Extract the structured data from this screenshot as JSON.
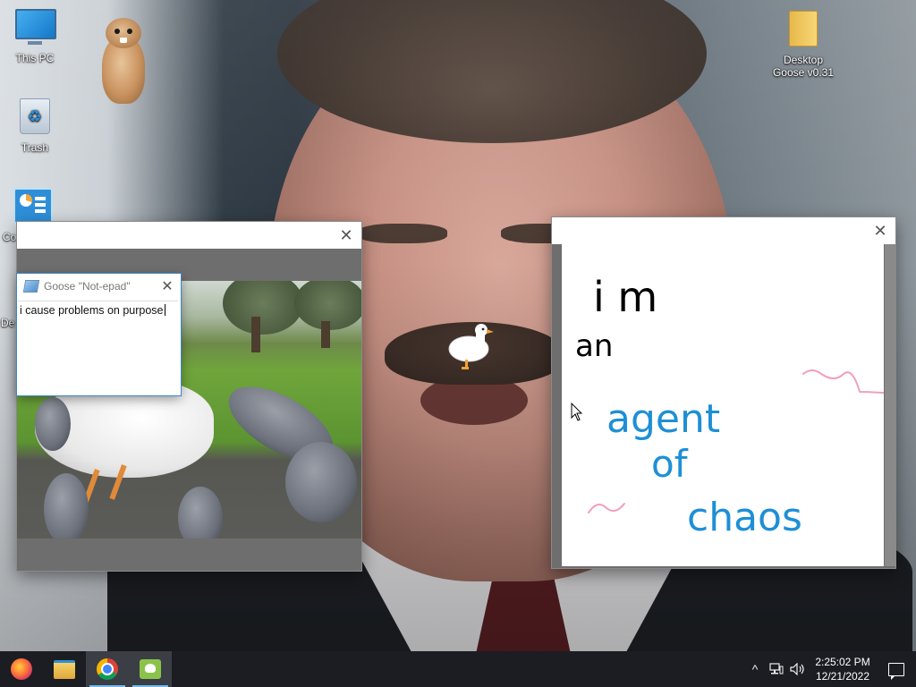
{
  "desktop": {
    "icons": [
      {
        "label": "This PC",
        "icon": "computer-icon"
      },
      {
        "label": "Trash",
        "icon": "recycle-bin-icon"
      },
      {
        "label": "Co",
        "icon": "control-panel-icon"
      },
      {
        "label": "De",
        "icon": "desktop-shortcut-icon"
      },
      {
        "label": "Desktop Goose v0.31",
        "icon": "folder-icon"
      }
    ],
    "gopher_sticker": "gopher-icon"
  },
  "windows": {
    "gif_viewer": {
      "close_label": "✕"
    },
    "notepad": {
      "title": "Goose \"Not-epad\"",
      "close_label": "✕",
      "text": "i cause problems on purpose"
    },
    "doodle": {
      "close_label": "✕",
      "lines": [
        "i m",
        "an",
        "agent",
        "of",
        "chaos"
      ],
      "colors": {
        "black_text": "#000000",
        "blue_text": "#1e8fd6",
        "pink_scribble": "#f0a0b8"
      }
    }
  },
  "taskbar": {
    "apps": [
      {
        "name": "Firefox",
        "icon": "firefox-icon"
      },
      {
        "name": "File Explorer",
        "icon": "file-explorer-icon"
      },
      {
        "name": "Google Chrome",
        "icon": "chrome-icon",
        "active": true
      },
      {
        "name": "Desktop Goose",
        "icon": "goose-app-icon",
        "active": true
      }
    ],
    "tray": {
      "chevron": "^",
      "time": "2:25:02 PM",
      "date": "12/21/2022"
    },
    "accent_color": "#76b9ed"
  }
}
